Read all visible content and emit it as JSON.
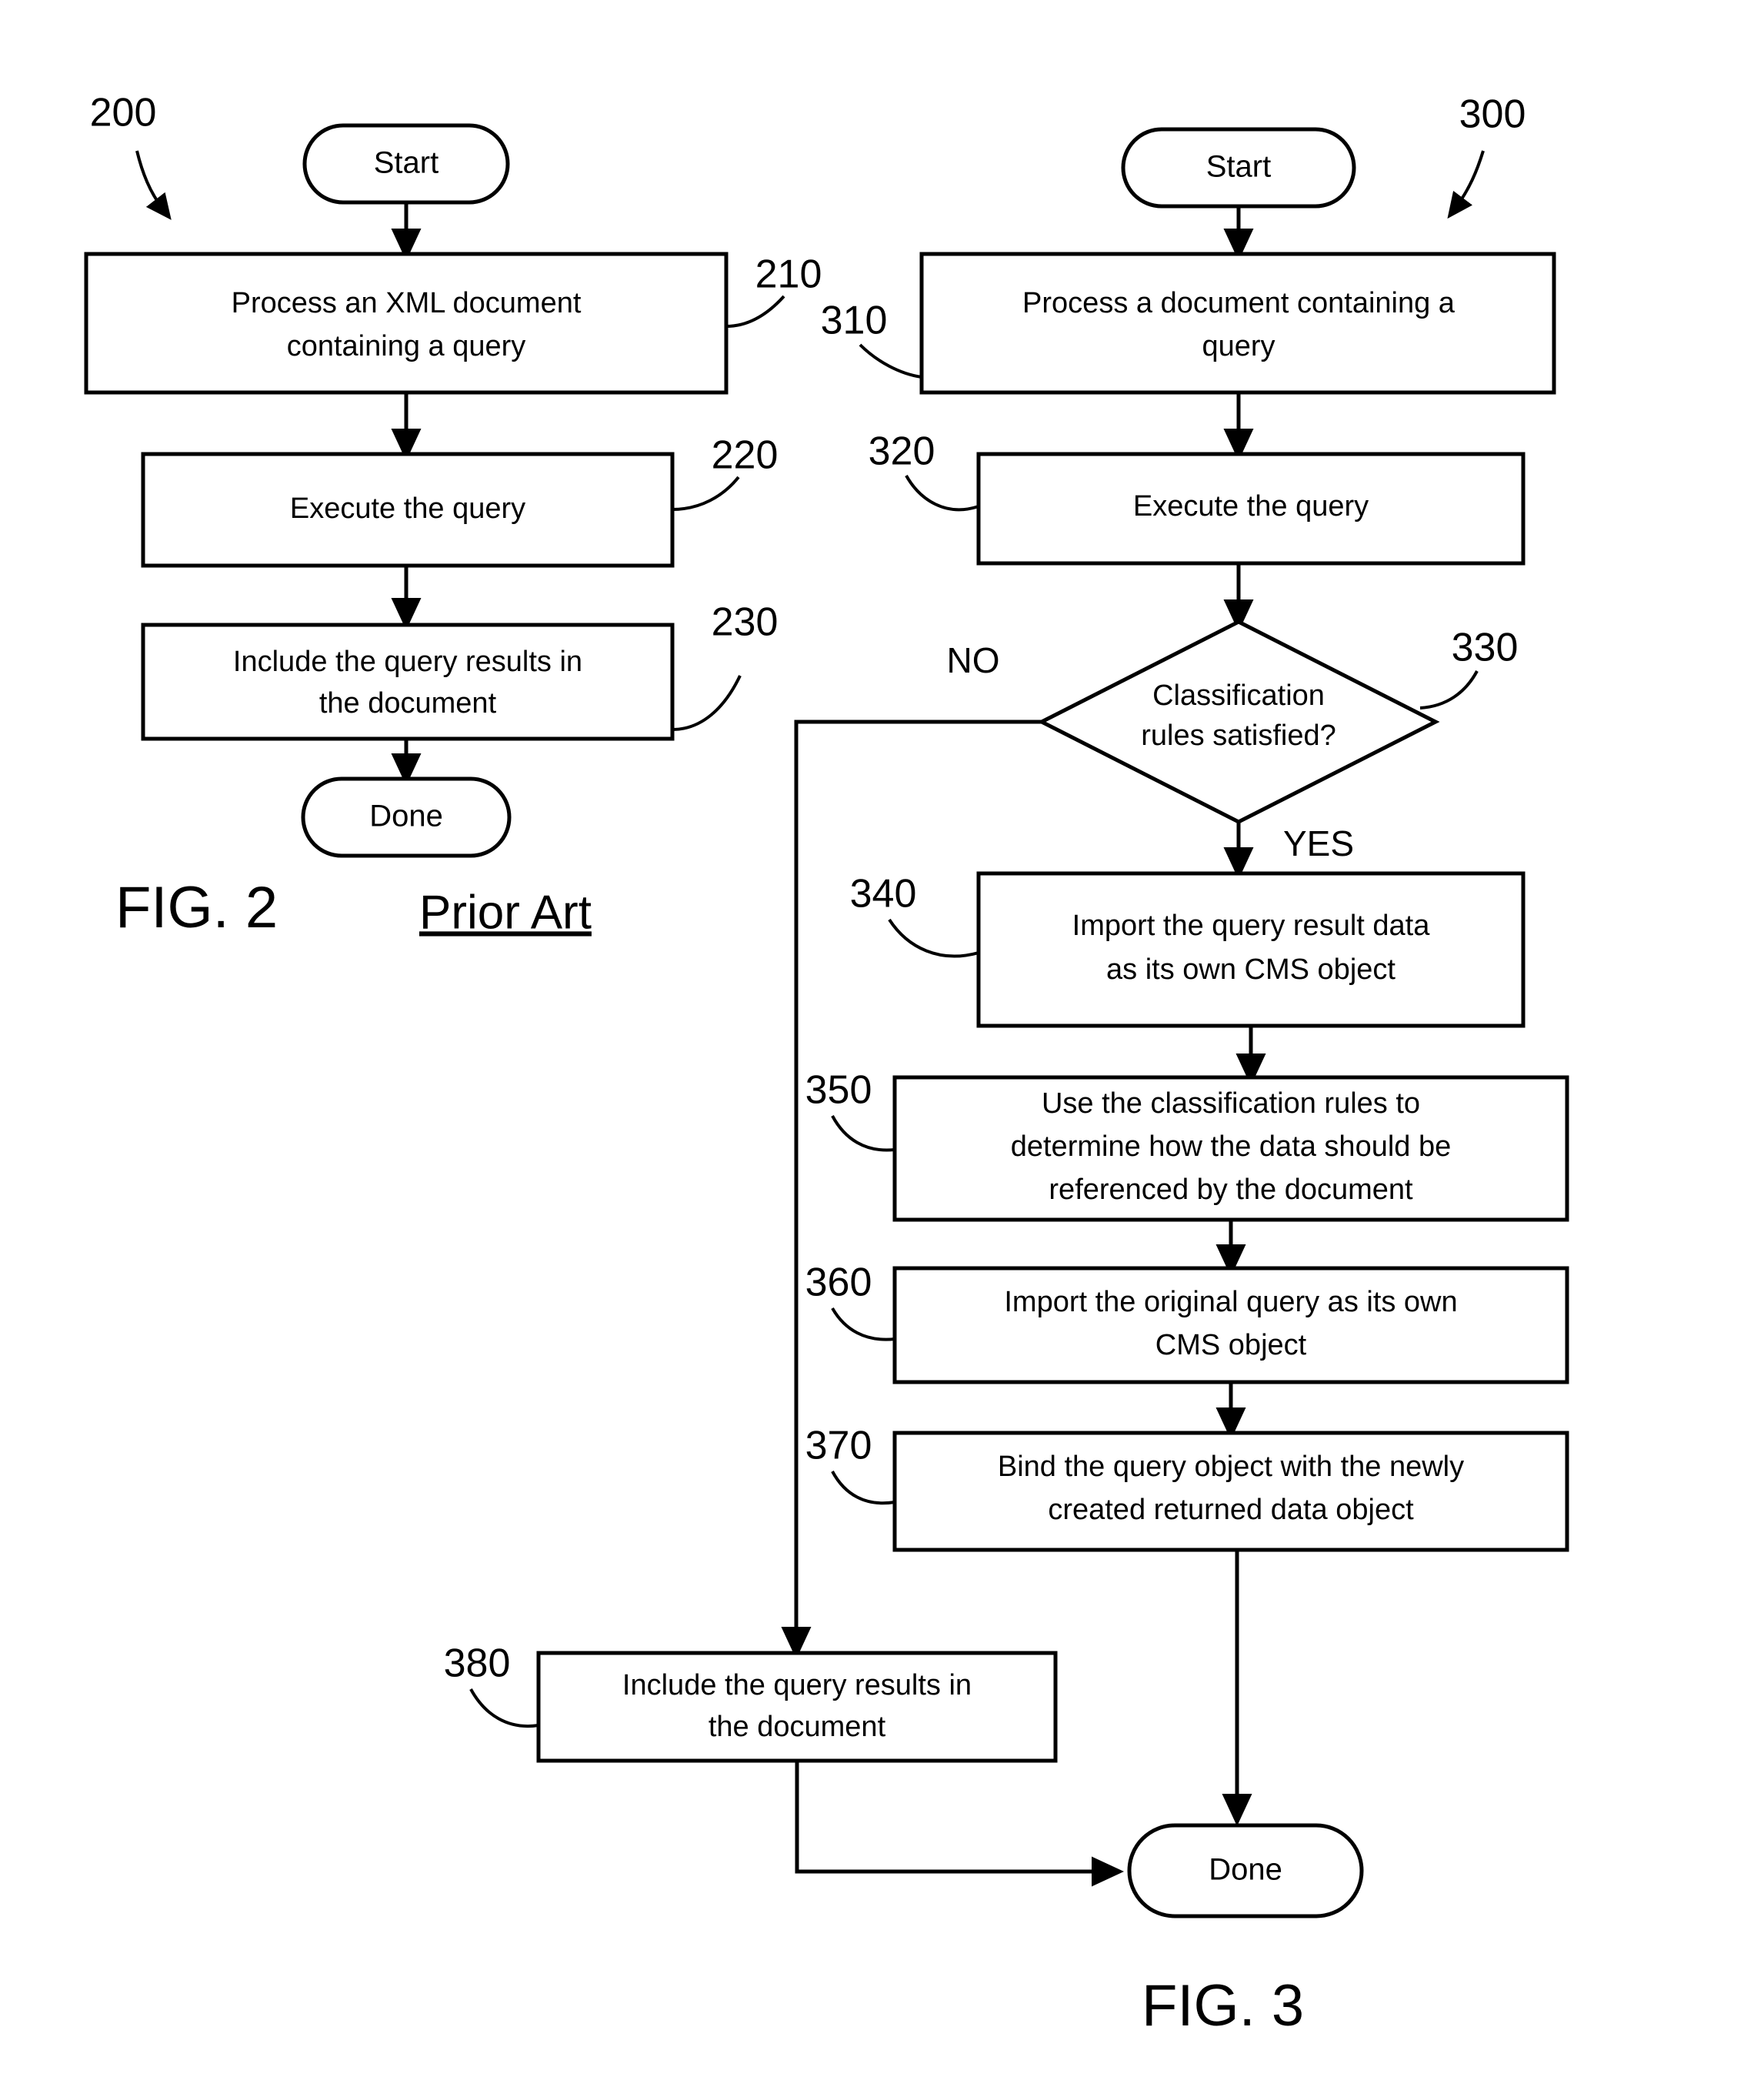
{
  "figures": [
    {
      "id": "fig2",
      "caption": "FIG. 2",
      "subcaption": "Prior Art",
      "ref_number": "200",
      "nodes": {
        "start": "Start",
        "step_210_line1": "Process an XML document",
        "step_210_line2": "containing a query",
        "step_220": "Execute the query",
        "step_230_line1": "Include the query results in",
        "step_230_line2": "the document",
        "done": "Done"
      },
      "ref_labels": {
        "r210": "210",
        "r220": "220",
        "r230": "230"
      }
    },
    {
      "id": "fig3",
      "caption": "FIG. 3",
      "ref_number": "300",
      "nodes": {
        "start": "Start",
        "step_310_line1": "Process a document containing a",
        "step_310_line2": "query",
        "step_320": "Execute the query",
        "step_330_line1": "Classification",
        "step_330_line2": "rules satisfied?",
        "step_340_line1": "Import the query result data",
        "step_340_line2": "as its own CMS object",
        "step_350_line1": "Use the classification rules to",
        "step_350_line2": "determine how the data should be",
        "step_350_line3": "referenced by the document",
        "step_360_line1": "Import the original query as its own",
        "step_360_line2": "CMS object",
        "step_370_line1": "Bind the query object with the newly",
        "step_370_line2": "created returned data object",
        "step_380_line1": "Include the query results in",
        "step_380_line2": "the document",
        "done": "Done"
      },
      "ref_labels": {
        "r310": "310",
        "r320": "320",
        "r330": "330",
        "r340": "340",
        "r350": "350",
        "r360": "360",
        "r370": "370",
        "r380": "380"
      },
      "branch_labels": {
        "no": "NO",
        "yes": "YES"
      }
    }
  ],
  "colors": {
    "stroke": "#000000",
    "fill": "#ffffff",
    "text": "#000000"
  }
}
